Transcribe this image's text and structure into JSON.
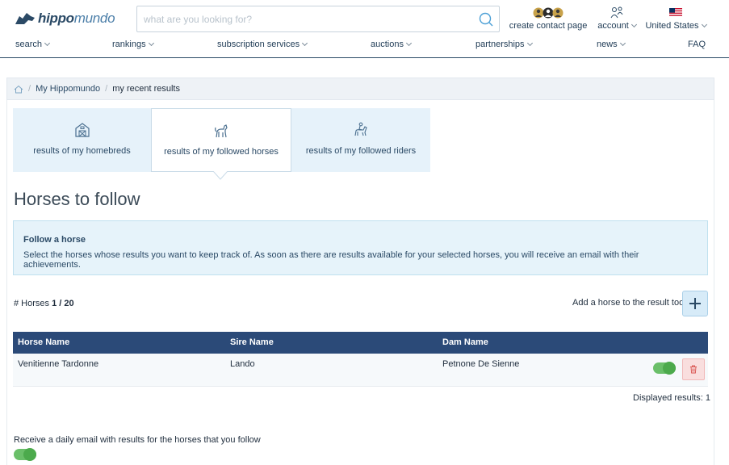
{
  "header": {
    "logo_bold": "hippo",
    "logo_light": "mundo",
    "search_placeholder": "what are you looking for?",
    "links": {
      "create_contact": "create contact page",
      "account": "account",
      "country": "United States"
    }
  },
  "nav": {
    "items": [
      "search",
      "rankings",
      "subscription services",
      "auctions",
      "partnerships",
      "news",
      "FAQ"
    ]
  },
  "breadcrumb": {
    "items": [
      "My Hippomundo",
      "my recent results"
    ]
  },
  "tabs": [
    {
      "label": "results of my homebreds",
      "icon": "stable-icon",
      "active": false
    },
    {
      "label": "results of my followed horses",
      "icon": "horse-icon",
      "active": true
    },
    {
      "label": "results of my followed riders",
      "icon": "rider-icon",
      "active": false
    }
  ],
  "main": {
    "title": "Horses to follow",
    "info": {
      "title": "Follow a horse",
      "text": "Select the horses whose results you want to keep track of. As soon as there are results available for your selected horses, you will receive an email with their achievements."
    },
    "count_label": "# Horses",
    "count_value": "1 / 20",
    "add_label": "Add a horse to the result tool",
    "table": {
      "headers": [
        "Horse Name",
        "Sire Name",
        "Dam Name"
      ],
      "rows": [
        {
          "horse": "Venitienne Tardonne",
          "sire": "Lando",
          "dam": "Petnone De Sienne",
          "following": true
        }
      ]
    },
    "displayed_results": "Displayed results: 1",
    "daily_email_label": "Receive a daily email with results for the horses that you follow",
    "daily_email_enabled": true
  },
  "colors": {
    "brand": "#2b4a66",
    "table_header": "#2b4a78",
    "toggle_on": "#4caa4c",
    "info_bg": "#e6f3fa",
    "delete_bg": "#f9dede"
  }
}
